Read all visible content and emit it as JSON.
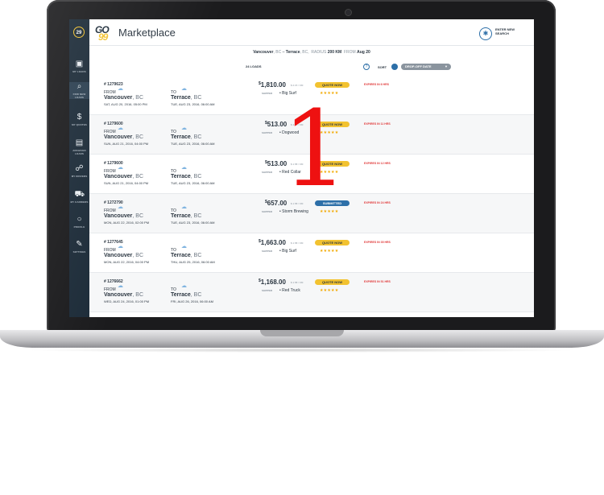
{
  "sidebar": {
    "badge": "29",
    "items": [
      {
        "label": "MY LOADS",
        "icon": "box-icon",
        "glyph": "▣"
      },
      {
        "label": "FIND NEW LOADS",
        "icon": "search-icon",
        "glyph": "⌕"
      },
      {
        "label": "MY QUOTES",
        "icon": "dollar-icon",
        "glyph": "$"
      },
      {
        "label": "ARCHIVED LOADS",
        "icon": "archive-icon",
        "glyph": "▤"
      },
      {
        "label": "MY DRIVERS",
        "icon": "drivers-icon",
        "glyph": "☍"
      },
      {
        "label": "MY CARRIERS",
        "icon": "truck-icon",
        "glyph": "⛟"
      },
      {
        "label": "PROFILE",
        "icon": "profile-icon",
        "glyph": "○"
      },
      {
        "label": "SETTINGS",
        "icon": "wrench-icon",
        "glyph": "✎"
      }
    ]
  },
  "header": {
    "logo_top": "GO",
    "logo_bottom": "99",
    "title": "Marketplace",
    "new_search": "ENTER NEW SEARCH"
  },
  "filter": {
    "origin": "Vancouver",
    "origin_prov": ", BC",
    "dash": " – ",
    "destination": "Terrace",
    "destination_prov": ", BC,",
    "radius_label": "RADIUS",
    "radius": "200 KM",
    "from_label": "FROM",
    "from_date": "Aug 20"
  },
  "toolbar": {
    "count": "24 LOADS",
    "help": "?",
    "sort_label": "SORT",
    "sort_value": "DROP-OFF DATE"
  },
  "loads": [
    {
      "id": "# 1279623",
      "from": "Vancouver",
      "to": "Terrace",
      "prov": ", BC",
      "from_date": "SAT, AUG 20, 2016, 05:00 PM",
      "to_date": "TUE, AUG 23, 2016, 06:00 AM",
      "price": "1,810.00",
      "rate": "$ 2.15 / KM",
      "shipper": "Big Surf",
      "button": "QUOTE NOW",
      "submitted": false,
      "expires": "EXPIRES IN 6 HRS"
    },
    {
      "id": "# 1279600",
      "from": "Vancouver",
      "to": "Terrace",
      "prov": ", BC",
      "from_date": "SUN, AUG 21, 2016, 04:00 PM",
      "to_date": "TUE, AUG 23, 2016, 06:00 AM",
      "price": "513.00",
      "rate": "$ 1.58 / KM",
      "shipper": "Dogwood",
      "button": "QUOTE NOW",
      "submitted": false,
      "expires": "EXPIRES IN 11 HRS"
    },
    {
      "id": "# 1279600",
      "from": "Vancouver",
      "to": "Terrace",
      "prov": ", BC",
      "from_date": "SUN, AUG 21, 2016, 04:00 PM",
      "to_date": "TUE, AUG 23, 2016, 06:00 AM",
      "price": "513.00",
      "rate": "$ 1.58 / KM",
      "shipper": "Red Collar",
      "button": "QUOTE NOW",
      "submitted": false,
      "expires": "EXPIRES IN 12 HRS"
    },
    {
      "id": "# 1272790",
      "from": "Vancouver",
      "to": "Terrace",
      "prov": ", BC",
      "from_date": "MON, AUG 22, 2016, 02:00 PM",
      "to_date": "TUE, AUG 23, 2016, 06:00 AM",
      "price": "657.00",
      "rate": "$ 1.58 / KM",
      "shipper": "Storm Brewing",
      "button": "SUBMITTED",
      "submitted": true,
      "expires": "EXPIRES IN 24 HRS"
    },
    {
      "id": "# 1277645",
      "from": "Vancouver",
      "to": "Terrace",
      "prov": ", BC",
      "from_date": "MON, AUG 22, 2016, 04:00 PM",
      "to_date": "THU, AUG 25, 2016, 06:00 AM",
      "price": "1,663.00",
      "rate": "$ 1.58 / KM",
      "shipper": "Big Surf",
      "button": "QUOTE NOW",
      "submitted": false,
      "expires": "EXPIRES IN 35 HRS"
    },
    {
      "id": "# 1276662",
      "from": "Vancouver",
      "to": "Terrace",
      "prov": ", BC",
      "from_date": "WED, AUG 24, 2016, 01:00 PM",
      "to_date": "FRI, AUG 26, 2016, 06:00 AM",
      "price": "1,168.00",
      "rate": "$ 1.58 / KM",
      "shipper": "Red Truck",
      "button": "QUOTE NOW",
      "submitted": false,
      "expires": "EXPIRES IN 51 HRS"
    }
  ],
  "labels": {
    "from": "FROM",
    "to": "TO",
    "shipper": "SHIPPER",
    "stars": "★★★★★",
    "currency": "$"
  },
  "overlay": {
    "number": "1"
  },
  "colors": {
    "accent": "#f2c230",
    "sidebar": "#1c2b38",
    "link": "#2d6fa8",
    "alert": "#e03a3a",
    "overlay": "#ee1111"
  }
}
